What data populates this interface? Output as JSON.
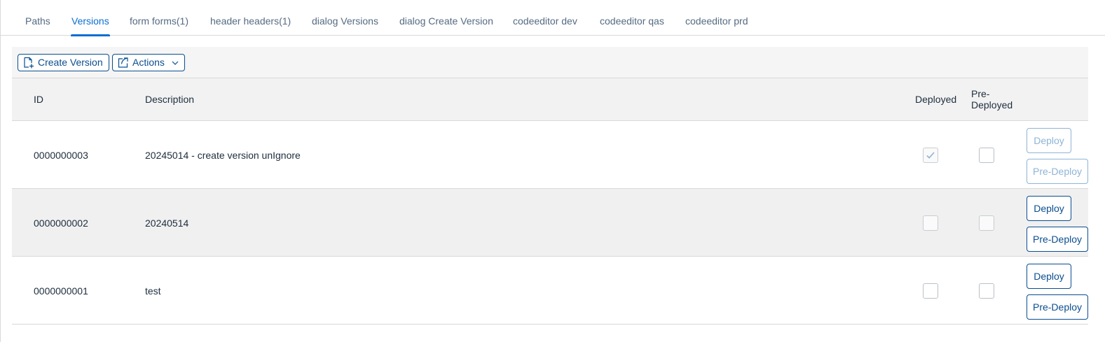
{
  "tabs": [
    {
      "label": "Paths",
      "active": false
    },
    {
      "label": "Versions",
      "active": true
    },
    {
      "label": "form forms(1)",
      "active": false
    },
    {
      "label": "header headers(1)",
      "active": false
    },
    {
      "label": "dialog Versions",
      "active": false
    },
    {
      "label": "dialog Create Version",
      "active": false
    },
    {
      "label": "codeeditor dev",
      "active": false
    },
    {
      "label": "codeeditor qas",
      "active": false
    },
    {
      "label": "codeeditor prd",
      "active": false
    }
  ],
  "toolbar": {
    "create_label": "Create Version",
    "create_icon": "create-document-icon",
    "actions_label": "Actions",
    "actions_icon": "share-action-icon"
  },
  "table": {
    "columns": {
      "id": "ID",
      "description": "Description",
      "deployed": "Deployed",
      "pre_deployed_line1": "Pre-",
      "pre_deployed_line2": "Deployed"
    },
    "rows": [
      {
        "id": "0000000003",
        "description": "20245014 - create version unIgnore",
        "deployed": true,
        "pre_deployed": false,
        "deploy_enabled": false,
        "pre_deploy_enabled": false,
        "deploy_label": "Deploy",
        "pre_deploy_label": "Pre-Deploy"
      },
      {
        "id": "0000000002",
        "description": "20240514",
        "deployed": false,
        "pre_deployed": false,
        "deploy_enabled": true,
        "pre_deploy_enabled": true,
        "deploy_label": "Deploy",
        "pre_deploy_label": "Pre-Deploy"
      },
      {
        "id": "0000000001",
        "description": "test",
        "deployed": false,
        "pre_deployed": false,
        "deploy_enabled": true,
        "pre_deploy_enabled": true,
        "deploy_label": "Deploy",
        "pre_deploy_label": "Pre-Deploy"
      }
    ]
  },
  "colors": {
    "accent": "#0a6ed1",
    "button_border": "#0a4e8f",
    "disabled": "#8fb4d6",
    "row_alt": "#f0f0f0"
  }
}
